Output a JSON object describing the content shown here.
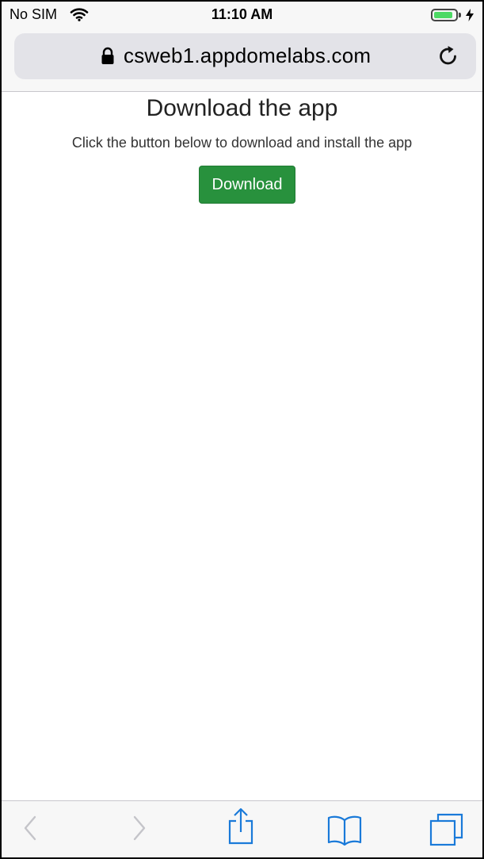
{
  "status_bar": {
    "carrier": "No SIM",
    "time": "11:10 AM",
    "battery_level": 0.9,
    "icons": [
      "wifi-icon",
      "battery-icon",
      "charging-bolt-icon"
    ]
  },
  "address_bar": {
    "url": "csweb1.appdomelabs.com",
    "icons": [
      "lock-icon",
      "reload-icon"
    ]
  },
  "page": {
    "title": "Download the app",
    "subtitle": "Click the button below to download and install the app",
    "download_label": "Download"
  },
  "toolbar": {
    "items": [
      "back-icon",
      "forward-icon",
      "share-icon",
      "bookmarks-icon",
      "tabs-icon"
    ]
  },
  "colors": {
    "download_button": "#28913d",
    "toolbar_icon": "#1a7ad9",
    "toolbar_icon_disabled": "#c4c4c9"
  }
}
